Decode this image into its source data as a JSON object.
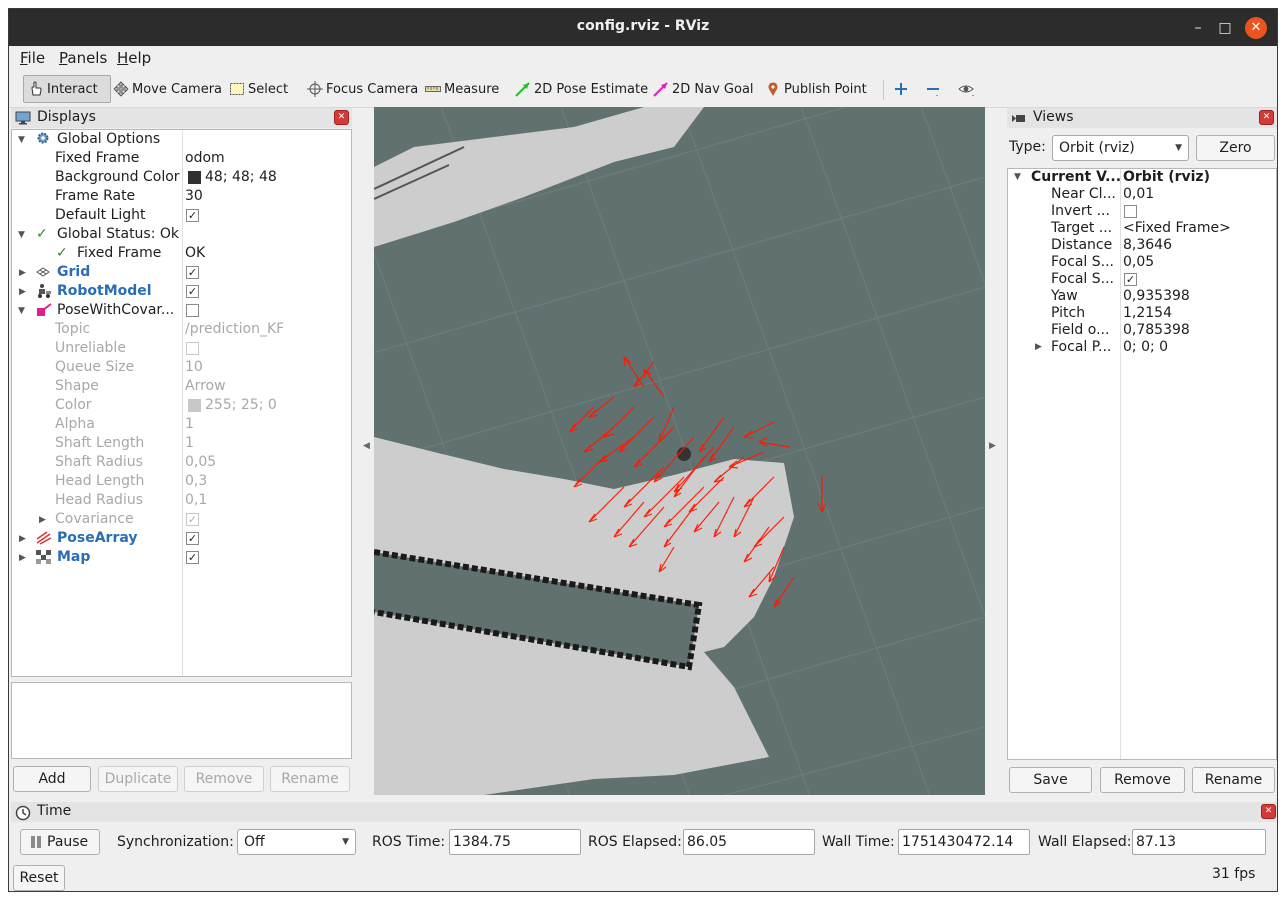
{
  "window": {
    "title": "config.rviz - RViz"
  },
  "menu": [
    "File",
    "Panels",
    "Help"
  ],
  "toolbar": {
    "tools": [
      {
        "label": "Interact",
        "icon": "hand-cursor-icon",
        "active": true
      },
      {
        "label": "Move Camera",
        "icon": "move-camera-icon"
      },
      {
        "label": "Select",
        "icon": "select-box-icon"
      },
      {
        "label": "Focus Camera",
        "icon": "focus-crosshair-icon"
      },
      {
        "label": "Measure",
        "icon": "ruler-icon"
      },
      {
        "label": "2D Pose Estimate",
        "icon": "green-arrow-icon"
      },
      {
        "label": "2D Nav Goal",
        "icon": "magenta-arrow-icon"
      },
      {
        "label": "Publish Point",
        "icon": "map-pin-icon"
      }
    ]
  },
  "displays": {
    "title": "Displays",
    "rows": [
      {
        "name": "Global Options",
        "value": ""
      },
      {
        "name": "Fixed Frame",
        "value": "odom"
      },
      {
        "name": "Background Color",
        "value": "48; 48; 48",
        "swatch": "#303030"
      },
      {
        "name": "Frame Rate",
        "value": "30"
      },
      {
        "name": "Default Light",
        "value": ""
      },
      {
        "name": "Global Status: Ok",
        "value": ""
      },
      {
        "name": "Fixed Frame",
        "value": "OK"
      },
      {
        "name": "Grid",
        "value": ""
      },
      {
        "name": "RobotModel",
        "value": ""
      },
      {
        "name": "PoseWithCovar...",
        "value": ""
      },
      {
        "name": "Topic",
        "value": "/prediction_KF"
      },
      {
        "name": "Unreliable",
        "value": ""
      },
      {
        "name": "Queue Size",
        "value": "10"
      },
      {
        "name": "Shape",
        "value": "Arrow"
      },
      {
        "name": "Color",
        "value": "255; 25; 0",
        "swatch": "#c8c8c8"
      },
      {
        "name": "Alpha",
        "value": "1"
      },
      {
        "name": "Shaft Length",
        "value": "1"
      },
      {
        "name": "Shaft Radius",
        "value": "0,05"
      },
      {
        "name": "Head Length",
        "value": "0,3"
      },
      {
        "name": "Head Radius",
        "value": "0,1"
      },
      {
        "name": "Covariance",
        "value": ""
      },
      {
        "name": "PoseArray",
        "value": ""
      },
      {
        "name": "Map",
        "value": ""
      }
    ],
    "buttons": [
      "Add",
      "Duplicate",
      "Remove",
      "Rename"
    ]
  },
  "views": {
    "title": "Views",
    "type_label": "Type:",
    "type_value": "Orbit (rviz)",
    "zero_label": "Zero",
    "rows": [
      {
        "name": "Current V...",
        "value": "Orbit (rviz)"
      },
      {
        "name": "Near Cl...",
        "value": "0,01"
      },
      {
        "name": "Invert ...",
        "value": ""
      },
      {
        "name": "Target ...",
        "value": "<Fixed Frame>"
      },
      {
        "name": "Distance",
        "value": "8,3646"
      },
      {
        "name": "Focal S...",
        "value": "0,05"
      },
      {
        "name": "Focal S...",
        "value": ""
      },
      {
        "name": "Yaw",
        "value": "0,935398"
      },
      {
        "name": "Pitch",
        "value": "1,2154"
      },
      {
        "name": "Field o...",
        "value": "0,785398"
      },
      {
        "name": "Focal P...",
        "value": "0; 0; 0"
      }
    ],
    "buttons": [
      "Save",
      "Remove",
      "Rename"
    ]
  },
  "time": {
    "title": "Time",
    "pause_label": "Pause",
    "sync_label": "Synchronization:",
    "sync_value": "Off",
    "ros_time_label": "ROS Time:",
    "ros_time": "1384.75",
    "ros_elapsed_label": "ROS Elapsed:",
    "ros_elapsed": "86.05",
    "wall_time_label": "Wall Time:",
    "wall_time": "1751430472.14",
    "wall_elapsed_label": "Wall Elapsed:",
    "wall_elapsed": "87.13",
    "reset_label": "Reset",
    "fps": "31 fps"
  },
  "colors": {
    "viewport_bg": "#607170",
    "free_space": "#cdcdcd",
    "pose_arrow": "#ff1900",
    "accent_blue": "#2a6db5"
  }
}
